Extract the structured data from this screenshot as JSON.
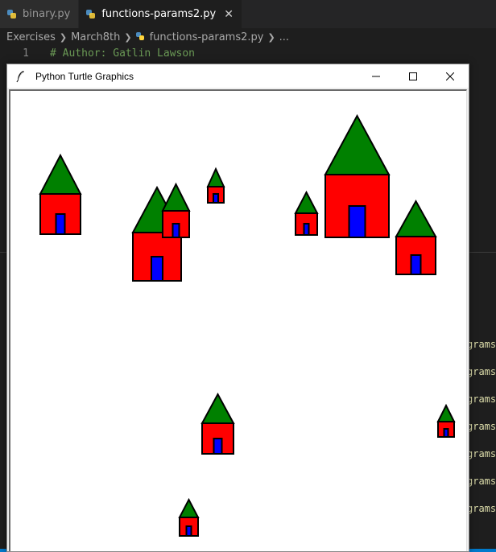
{
  "tabs": [
    {
      "label": "binary.py",
      "active": false
    },
    {
      "label": "functions-params2.py",
      "active": true,
      "close": "✕"
    }
  ],
  "breadcrumb": {
    "items": [
      "Exercises",
      "March8th",
      "functions-params2.py",
      "..."
    ]
  },
  "editor": {
    "line_number": "1",
    "line_text": "# Author: Gatlin Lawson"
  },
  "background_terminal": {
    "lines": [
      "grams",
      "grams",
      "grams",
      "grams",
      "grams",
      "grams",
      "grams"
    ]
  },
  "turtle_window": {
    "title": "Python Turtle Graphics",
    "buttons": {
      "minimize": "minimize",
      "maximize": "maximize",
      "close": "close"
    }
  },
  "colors": {
    "roof": "#008000",
    "wall": "#ff0000",
    "door": "#0000ff",
    "outline": "#000000",
    "canvas_bg": "#ffffff",
    "editor_bg": "#1e1e1e",
    "comment": "#6a9955",
    "terminal_text": "#dcdcaa"
  },
  "houses": [
    {
      "size": "large",
      "count_label": "house"
    },
    {
      "size": "large",
      "count_label": "house"
    },
    {
      "size": "medium",
      "count_label": "house"
    },
    {
      "size": "small",
      "count_label": "house"
    },
    {
      "size": "small",
      "count_label": "house"
    },
    {
      "size": "xlarge",
      "count_label": "house"
    },
    {
      "size": "large",
      "count_label": "house"
    },
    {
      "size": "large",
      "count_label": "house"
    },
    {
      "size": "small",
      "count_label": "house"
    },
    {
      "size": "small",
      "count_label": "house"
    }
  ]
}
